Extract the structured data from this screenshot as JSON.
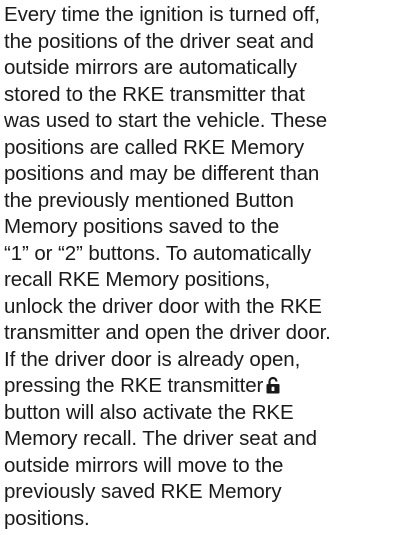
{
  "paragraph": {
    "lines": [
      "Every time the ignition is turned off,",
      "the positions of the driver seat and",
      "outside mirrors are automatically",
      "stored to the RKE transmitter that",
      "was used to start the vehicle. These",
      "positions are called RKE Memory",
      "positions and may be different than",
      "the previously mentioned Button",
      "Memory positions saved to the",
      "“1” or “2” buttons. To automatically",
      "recall RKE Memory positions,",
      "unlock the driver door with the RKE",
      "transmitter and open the driver door.",
      "If the driver door is already open,",
      "pressing the RKE transmitter",
      "button will also activate the RKE",
      "Memory recall. The driver seat and",
      "outside mirrors will move to the",
      "previously saved RKE Memory",
      "positions."
    ],
    "icon": "unlock-padlock-icon"
  }
}
